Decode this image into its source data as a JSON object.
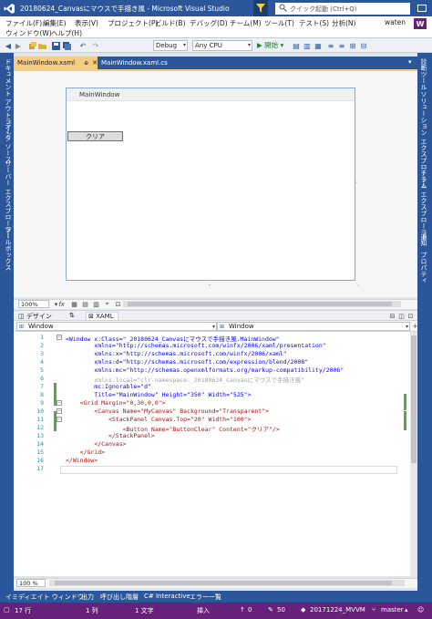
{
  "window": {
    "title": "20180624_Canvasにマウスで手描き風 - Microsoft Visual Studio",
    "quick_launch_placeholder": "クイック起動 (Ctrl+Q)"
  },
  "menu": {
    "row1": [
      "ファイル(F)",
      "編集(E)",
      "表示(V)",
      "プロジェクト(P)",
      "ビルド(B)",
      "デバッグ(D)",
      "チーム(M)",
      "ツール(T)",
      "テスト(S)",
      "分析(N)"
    ],
    "row2": [
      "ウィンドウ(W)",
      "ヘルプ(H)"
    ],
    "user": "waten",
    "user_initial": "W"
  },
  "toolbar": {
    "config": "Debug",
    "platform": "Any CPU",
    "start_label": "▶ 開始 ▾"
  },
  "left_tabs": [
    "ドキュメント アウトライン",
    "データ ソース",
    "サーバー エクスプローラー",
    "ツールボックス"
  ],
  "right_tabs": [
    "診断ツール",
    "ソリューション エクスプローラー",
    "チーム エクスプローラー",
    "通知",
    "プロパティ"
  ],
  "doc_tabs": {
    "active": "MainWindow.xaml",
    "inactive": "MainWindow.xaml.cs"
  },
  "designer": {
    "window_title": "MainWindow",
    "button_label": "クリア",
    "zoom": "100%"
  },
  "split_tabs": {
    "design": "デザイン",
    "swap": "⇅",
    "xaml": "XAML"
  },
  "nav": {
    "left": "Window",
    "right": "Window"
  },
  "editor": {
    "line_numbers": [
      "1",
      "2",
      "3",
      "4",
      "5",
      "6",
      "7",
      "8",
      "9",
      "10",
      "11",
      "12",
      "13",
      "14",
      "15",
      "16"
    ],
    "lines": [
      "<Window x:Class=\"_20180624_Canvasにマウスで手描き風.MainWindow\"",
      "        xmlns=\"http://schemas.microsoft.com/winfx/2006/xaml/presentation\"",
      "        xmlns:x=\"http://schemas.microsoft.com/winfx/2006/xaml\"",
      "        xmlns:d=\"http://schemas.microsoft.com/expression/blend/2008\"",
      "        xmlns:mc=\"http://schemas.openxmlformats.org/markup-compatibility/2006\"",
      "        xmlns:local=\"clr-namespace:_20180624_Canvasにマウスで手描き風\"",
      "        mc:Ignorable=\"d\"",
      "        Title=\"MainWindow\" Height=\"350\" Width=\"525\">",
      "    <Grid Margin=\"0,30,0,0\">",
      "        <Canvas Name=\"MyCanvas\" Background=\"Transparent\">",
      "            <StackPanel Canvas.Top=\"20\" Width=\"100\">",
      "                <Button Name=\"ButtonClear\" Content=\"クリア\"/>",
      "            </StackPanel>",
      "        </Canvas>",
      "    </Grid>",
      "</Window>"
    ],
    "zoom": "100 %"
  },
  "bottom_tabs": [
    "イミディエイト ウィンドウ",
    "出力",
    "呼び出し階層",
    "C# Interactive",
    "エラー一覧"
  ],
  "status": {
    "line": "17 行",
    "col": "1 列",
    "char": "1 文字",
    "mode": "挿入",
    "up": "0",
    "pencil": "50",
    "repo": "20171224_MVVM",
    "branch": "master"
  }
}
